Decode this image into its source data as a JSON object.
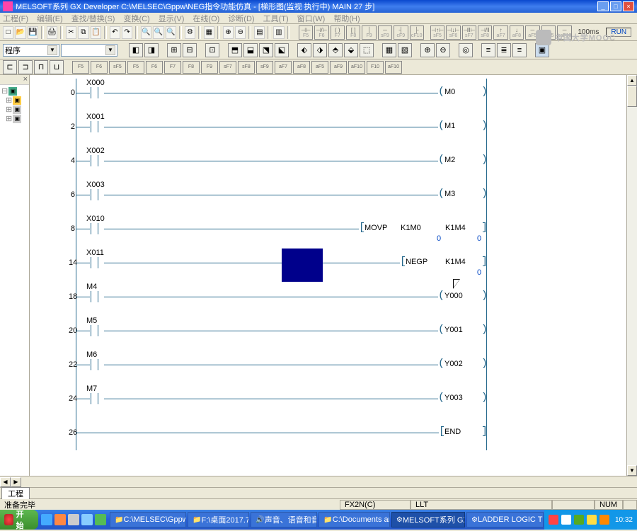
{
  "title": "MELSOFT系列 GX Developer C:\\MELSEC\\Gppw\\NEG指令功能仿真 - [梯形图(监视 执行中)    MAIN    27 步]",
  "menu": [
    "工程(F)",
    "编辑(E)",
    "查找/替换(S)",
    "变换(C)",
    "显示(V)",
    "在线(O)",
    "诊断(D)",
    "工具(T)",
    "窗口(W)",
    "帮助(H)"
  ],
  "fkeys_top": [
    "|-|",
    "|/|",
    "()",
    "{}",
    "|",
    "-",
    "|↑",
    "|↓",
    "|-‖",
    "|/‖",
    "()P",
    "{}P",
    "",
    "",
    "",
    ""
  ],
  "fkeys_shift": [
    "+F5",
    "+F6",
    "",
    "",
    "+F7",
    "+F8",
    "",
    "",
    "aF5",
    "caF5",
    "caF6",
    "aF7",
    "aF8"
  ],
  "ms_label": "100ms",
  "run_label": "RUN",
  "combo1": "程序",
  "combo2": "",
  "watermark": "中国大学MOOC",
  "rungs": [
    {
      "step": "0",
      "contact": "X000",
      "coil": "M0",
      "type": "coil"
    },
    {
      "step": "2",
      "contact": "X001",
      "coil": "M1",
      "type": "coil"
    },
    {
      "step": "4",
      "contact": "X002",
      "coil": "M2",
      "type": "coil"
    },
    {
      "step": "6",
      "contact": "X003",
      "coil": "M3",
      "type": "coil"
    },
    {
      "step": "8",
      "contact": "X010",
      "type": "box",
      "op": "MOVP",
      "arg1": "K1M0",
      "arg2": "K1M4",
      "v1": "0",
      "v2": "0"
    },
    {
      "step": "14",
      "contact": "X011",
      "type": "box",
      "op": "NEGP",
      "arg1": "",
      "arg2": "K1M4",
      "v2": "0"
    },
    {
      "step": "18",
      "contact": "M4",
      "coil": "Y000",
      "type": "coil"
    },
    {
      "step": "20",
      "contact": "M5",
      "coil": "Y001",
      "type": "coil"
    },
    {
      "step": "22",
      "contact": "M6",
      "coil": "Y002",
      "type": "coil"
    },
    {
      "step": "24",
      "contact": "M7",
      "coil": "Y003",
      "type": "coil"
    },
    {
      "step": "26",
      "contact": "",
      "type": "end",
      "op": "END"
    }
  ],
  "sheet_tab": "工程",
  "status": {
    "ready": "准备完毕",
    "cpu": "FX2N(C)",
    "conn": "LLT",
    "num": "NUM"
  },
  "taskbar": {
    "start": "开始",
    "tasks": [
      "C:\\MELSEC\\Gppw\\...",
      "F:\\桌面2017.7.2",
      "声音、语音和音...",
      "C:\\Documents an...",
      "MELSOFT系列 GX...",
      "LADDER LOGIC TE..."
    ],
    "clock": "10:32"
  }
}
